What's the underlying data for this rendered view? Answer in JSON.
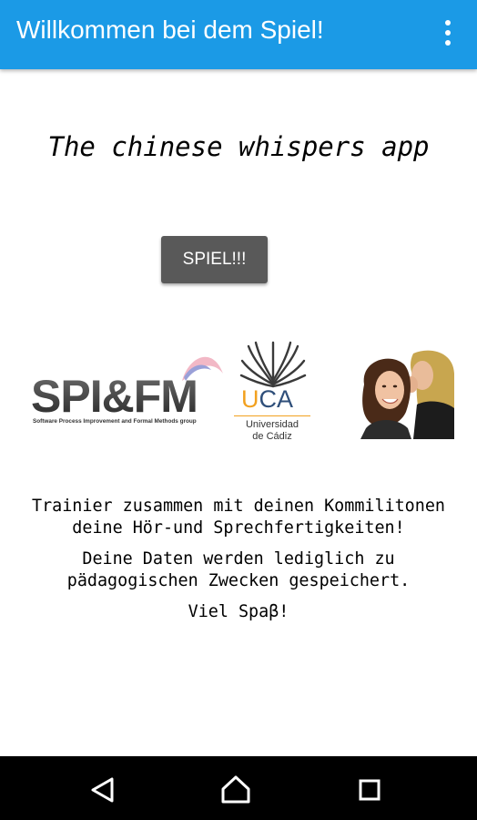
{
  "app_bar": {
    "title": "Willkommen bei dem Spiel!",
    "color": "#1b9ae6",
    "menu_icon": "more-vert-icon"
  },
  "main": {
    "headline": "The chinese whispers app",
    "start_button": "SPIEL!!!",
    "logos": {
      "spifm": {
        "name": "SPI&FM",
        "subtitle": "Software Process Improvement and Formal Methods group"
      },
      "uca": {
        "letters_u": "U",
        "letters_ca": "CA",
        "line1": "Universidad",
        "line2": "de Cádiz"
      }
    },
    "text_lines": [
      "Trainier zusammen mit deinen Kommilitonen",
      "deine Hör-und Sprechfertigkeiten!",
      "Deine Daten werden lediglich zu",
      "pädagogischen Zwecken gespeichert.",
      "Viel Spaβ!"
    ]
  },
  "nav_bar": {
    "back_icon": "back-triangle-icon",
    "home_icon": "home-icon",
    "recent_icon": "recent-apps-square-icon"
  }
}
